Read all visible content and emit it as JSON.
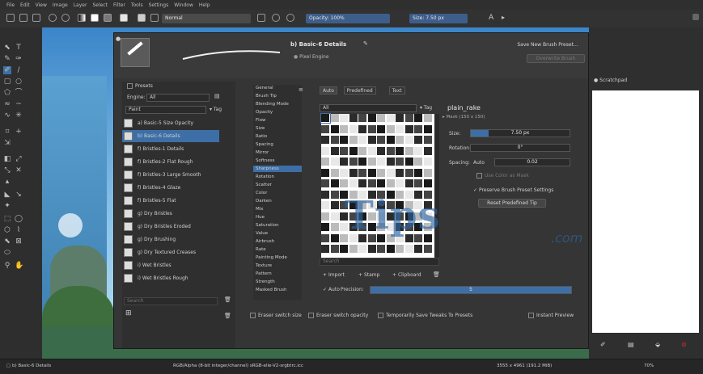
{
  "menu": [
    "File",
    "Edit",
    "View",
    "Image",
    "Layer",
    "Select",
    "Filter",
    "Tools",
    "Settings",
    "Window",
    "Help"
  ],
  "toolbar": {
    "blend_mode": "Normal",
    "opacity": "Opacity: 100%",
    "size": "Size: 7.50 px"
  },
  "brush_header": {
    "name": "b) Basic-6 Details",
    "engine": "Pixel Engine",
    "save_new": "Save New Brush Preset...",
    "overwrite": "Overwrite Brush"
  },
  "presets": {
    "title": "Presets",
    "engine_label": "Engine:",
    "engine_value": "All",
    "tag_filter": "Paint",
    "tag_label": "Tag",
    "items": [
      {
        "label": "a) Basic-5 Size Opacity",
        "selected": false
      },
      {
        "label": "b) Basic-6 Details",
        "selected": true
      },
      {
        "label": "f) Bristles-1 Details",
        "selected": false
      },
      {
        "label": "f) Bristles-2 Flat Rough",
        "selected": false
      },
      {
        "label": "f) Bristles-3 Large Smooth",
        "selected": false
      },
      {
        "label": "f) Bristles-4 Glaze",
        "selected": false
      },
      {
        "label": "f) Bristles-5 Flat",
        "selected": false
      },
      {
        "label": "g) Dry Bristles",
        "selected": false
      },
      {
        "label": "g) Dry Bristles Eroded",
        "selected": false
      },
      {
        "label": "g) Dry Brushing",
        "selected": false
      },
      {
        "label": "g) Dry Textured Creases",
        "selected": false
      },
      {
        "label": "i) Wet Bristles",
        "selected": false
      },
      {
        "label": "i) Wet Bristles Rough",
        "selected": false
      }
    ],
    "search_placeholder": "Search"
  },
  "options": {
    "items": [
      {
        "label": "General",
        "selected": false
      },
      {
        "label": "Brush Tip",
        "selected": false
      },
      {
        "label": "Blending Mode",
        "selected": false
      },
      {
        "label": "Opacity",
        "selected": false
      },
      {
        "label": "Flow",
        "selected": false
      },
      {
        "label": "Size",
        "selected": false
      },
      {
        "label": "Ratio",
        "selected": false
      },
      {
        "label": "Spacing",
        "selected": false
      },
      {
        "label": "Mirror",
        "selected": false
      },
      {
        "label": "Softness",
        "selected": false
      },
      {
        "label": "Sharpness",
        "selected": true
      },
      {
        "label": "Rotation",
        "selected": false
      },
      {
        "label": "Scatter",
        "selected": false
      },
      {
        "label": "Color",
        "selected": false
      },
      {
        "label": "Darken",
        "selected": false
      },
      {
        "label": "Mix",
        "selected": false
      },
      {
        "label": "Hue",
        "selected": false
      },
      {
        "label": "Saturation",
        "selected": false
      },
      {
        "label": "Value",
        "selected": false
      },
      {
        "label": "Airbrush",
        "selected": false
      },
      {
        "label": "Rate",
        "selected": false
      },
      {
        "label": "Painting Mode",
        "selected": false
      },
      {
        "label": "Texture",
        "selected": false
      },
      {
        "label": "Pattern",
        "selected": false
      },
      {
        "label": "Strength",
        "selected": false
      },
      {
        "label": "Masked Brush",
        "selected": false
      }
    ]
  },
  "tip": {
    "tabs": [
      "Auto",
      "Predefined",
      "Text"
    ],
    "filter": "All",
    "tag_label": "Tag",
    "tip_name": "plain_rake",
    "tip_mask": "Mask (150 x 150)",
    "size_label": "Size:",
    "size_value": "7.50 px",
    "rotation_label": "Rotation:",
    "rotation_value": "0°",
    "spacing_label": "Spacing:",
    "spacing_auto": "Auto",
    "spacing_value": "0.02",
    "use_color": "Use Color as Mask",
    "preserve": "Preserve Brush Preset Settings",
    "reset": "Reset Predefined Tip",
    "search_placeholder": "Search",
    "import": "Import",
    "stamp": "Stamp",
    "clipboard": "Clipboard",
    "precision_auto": "Auto",
    "precision_label": "Precision:",
    "precision_value": "5"
  },
  "bottom_options": {
    "eraser_size": "Eraser switch size",
    "eraser_opacity": "Eraser switch opacity",
    "temp_save": "Temporarily Save Tweaks To Presets",
    "instant": "Instant Preview"
  },
  "scratchpad": {
    "title": "Scratchpad"
  },
  "watermark": {
    "main": "Tips",
    "suffix": ".com"
  },
  "status": {
    "brush": "b) Basic-6 Details",
    "color": "RGB/Alpha (8-bit integer/channel)  sRGB-elle-V2-srgbtrc.icc",
    "dims": "3555 x 4961 (191.2 MiB)",
    "zoom": "70%"
  },
  "colors": {
    "accent": "#3d6fa6",
    "background": "#2b2b2b",
    "watermark": "#2d64a0"
  }
}
